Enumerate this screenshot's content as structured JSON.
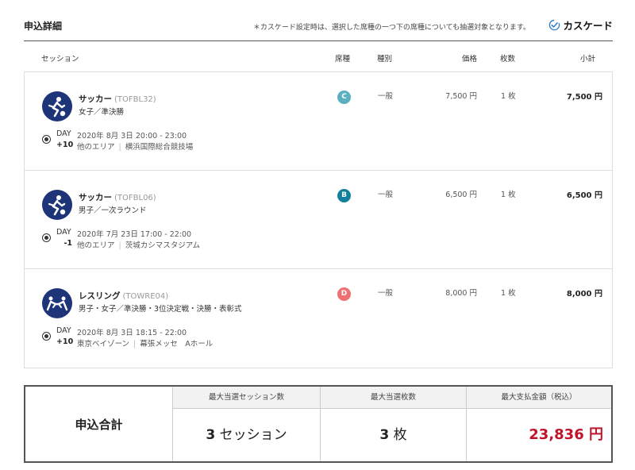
{
  "header": {
    "title": "申込詳細",
    "note": "＊カスケード設定時は、選択した席種の一つ下の席種についても抽選対象となります。",
    "cascade_label": "カスケード"
  },
  "columns": {
    "session": "セッション",
    "seat": "席種",
    "category": "種別",
    "price": "価格",
    "qty": "枚数",
    "subtotal": "小計"
  },
  "sessions": [
    {
      "sport": "サッカー",
      "code": "(TOFBL32)",
      "event": "女子／準決勝",
      "day_label": "DAY",
      "day_offset": "+10",
      "datetime": "2020年 8月 3日 20:00 - 23:00",
      "area": "他のエリア",
      "venue": "横浜国際総合競技場",
      "seat": "C",
      "seat_color": "#5aafc0",
      "category": "一般",
      "price": "7,500 円",
      "qty": "1 枚",
      "subtotal": "7,500 円",
      "icon": "football-icon"
    },
    {
      "sport": "サッカー",
      "code": "(TOFBL06)",
      "event": "男子／一次ラウンド",
      "day_label": "DAY",
      "day_offset": "-1",
      "datetime": "2020年 7月 23日 17:00 - 22:00",
      "area": "他のエリア",
      "venue": "茨城カシマスタジアム",
      "seat": "B",
      "seat_color": "#12809c",
      "category": "一般",
      "price": "6,500 円",
      "qty": "1 枚",
      "subtotal": "6,500 円",
      "icon": "football-icon"
    },
    {
      "sport": "レスリング",
      "code": "(TOWRE04)",
      "event": "男子・女子／準決勝・3位決定戦・決勝・表彰式",
      "day_label": "DAY",
      "day_offset": "+10",
      "datetime": "2020年 8月 3日 18:15 - 22:00",
      "area": "東京ベイゾーン",
      "venue": "幕張メッセ　Aホール",
      "seat": "D",
      "seat_color": "#ef6f72",
      "category": "一般",
      "price": "8,000 円",
      "qty": "1 枚",
      "subtotal": "8,000 円",
      "icon": "wrestling-icon"
    }
  ],
  "summary": {
    "label": "申込合計",
    "sessions_head": "最大当選セッション数",
    "sessions_num": "3",
    "sessions_unit": "セッション",
    "tickets_head": "最大当選枚数",
    "tickets_num": "3",
    "tickets_unit": "枚",
    "amount_head": "最大支払金額（税込）",
    "amount": "23,836 円"
  }
}
